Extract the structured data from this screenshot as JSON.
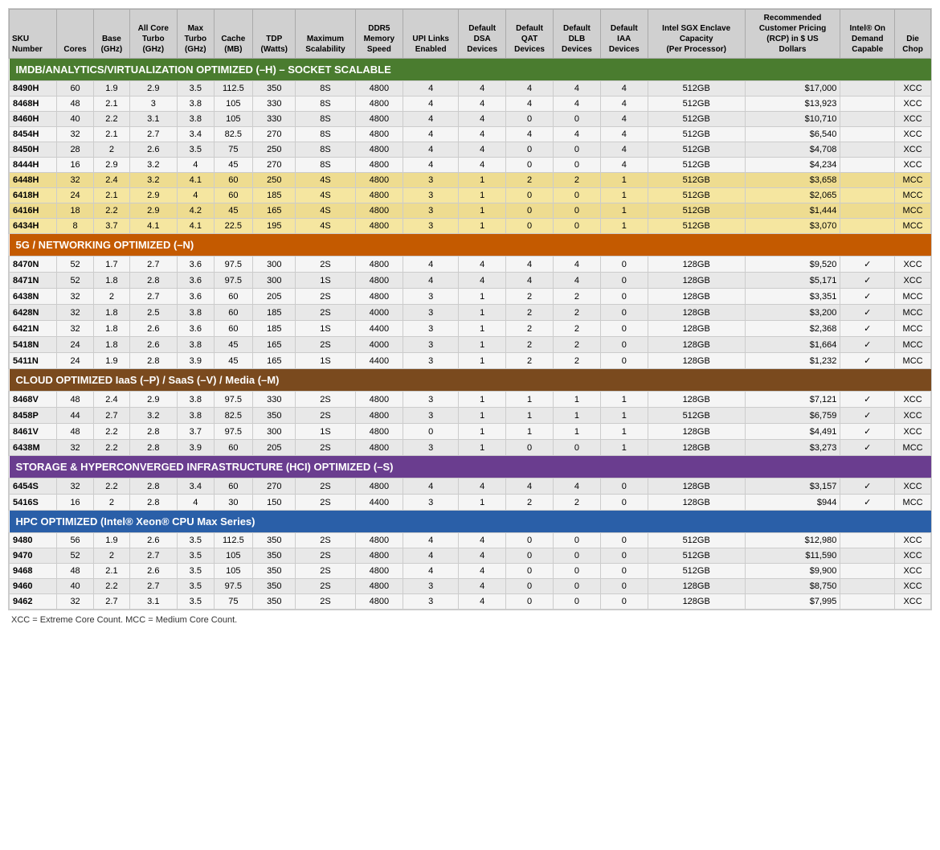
{
  "sections": [
    {
      "id": "imdb",
      "header": "IMDB/ANALYTICS/VIRTUALIZATION OPTIMIZED (–H) – SOCKET SCALABLE",
      "headerClass": "green-header",
      "rows": [
        {
          "sku": "8490H",
          "cores": "60",
          "base": "1.9",
          "allCore": "2.9",
          "maxTurbo": "3.5",
          "cache": "112.5",
          "tdp": "350",
          "maxScal": "8S",
          "ddr5": "4800",
          "upi": "4",
          "dsa": "4",
          "qat": "4",
          "dlb": "4",
          "iaa": "4",
          "sgx": "512GB",
          "price": "$17,000",
          "onDemand": "",
          "chop": "XCC",
          "yellow": false
        },
        {
          "sku": "8468H",
          "cores": "48",
          "base": "2.1",
          "allCore": "3",
          "maxTurbo": "3.8",
          "cache": "105",
          "tdp": "330",
          "maxScal": "8S",
          "ddr5": "4800",
          "upi": "4",
          "dsa": "4",
          "qat": "4",
          "dlb": "4",
          "iaa": "4",
          "sgx": "512GB",
          "price": "$13,923",
          "onDemand": "",
          "chop": "XCC",
          "yellow": false
        },
        {
          "sku": "8460H",
          "cores": "40",
          "base": "2.2",
          "allCore": "3.1",
          "maxTurbo": "3.8",
          "cache": "105",
          "tdp": "330",
          "maxScal": "8S",
          "ddr5": "4800",
          "upi": "4",
          "dsa": "4",
          "qat": "0",
          "dlb": "0",
          "iaa": "4",
          "sgx": "512GB",
          "price": "$10,710",
          "onDemand": "",
          "chop": "XCC",
          "yellow": false
        },
        {
          "sku": "8454H",
          "cores": "32",
          "base": "2.1",
          "allCore": "2.7",
          "maxTurbo": "3.4",
          "cache": "82.5",
          "tdp": "270",
          "maxScal": "8S",
          "ddr5": "4800",
          "upi": "4",
          "dsa": "4",
          "qat": "4",
          "dlb": "4",
          "iaa": "4",
          "sgx": "512GB",
          "price": "$6,540",
          "onDemand": "",
          "chop": "XCC",
          "yellow": false
        },
        {
          "sku": "8450H",
          "cores": "28",
          "base": "2",
          "allCore": "2.6",
          "maxTurbo": "3.5",
          "cache": "75",
          "tdp": "250",
          "maxScal": "8S",
          "ddr5": "4800",
          "upi": "4",
          "dsa": "4",
          "qat": "0",
          "dlb": "0",
          "iaa": "4",
          "sgx": "512GB",
          "price": "$4,708",
          "onDemand": "",
          "chop": "XCC",
          "yellow": false
        },
        {
          "sku": "8444H",
          "cores": "16",
          "base": "2.9",
          "allCore": "3.2",
          "maxTurbo": "4",
          "cache": "45",
          "tdp": "270",
          "maxScal": "8S",
          "ddr5": "4800",
          "upi": "4",
          "dsa": "4",
          "qat": "0",
          "dlb": "0",
          "iaa": "4",
          "sgx": "512GB",
          "price": "$4,234",
          "onDemand": "",
          "chop": "XCC",
          "yellow": false
        },
        {
          "sku": "6448H",
          "cores": "32",
          "base": "2.4",
          "allCore": "3.2",
          "maxTurbo": "4.1",
          "cache": "60",
          "tdp": "250",
          "maxScal": "4S",
          "ddr5": "4800",
          "upi": "3",
          "dsa": "1",
          "qat": "2",
          "dlb": "2",
          "iaa": "1",
          "sgx": "512GB",
          "price": "$3,658",
          "onDemand": "",
          "chop": "MCC",
          "yellow": true
        },
        {
          "sku": "6418H",
          "cores": "24",
          "base": "2.1",
          "allCore": "2.9",
          "maxTurbo": "4",
          "cache": "60",
          "tdp": "185",
          "maxScal": "4S",
          "ddr5": "4800",
          "upi": "3",
          "dsa": "1",
          "qat": "0",
          "dlb": "0",
          "iaa": "1",
          "sgx": "512GB",
          "price": "$2,065",
          "onDemand": "",
          "chop": "MCC",
          "yellow": true
        },
        {
          "sku": "6416H",
          "cores": "18",
          "base": "2.2",
          "allCore": "2.9",
          "maxTurbo": "4.2",
          "cache": "45",
          "tdp": "165",
          "maxScal": "4S",
          "ddr5": "4800",
          "upi": "3",
          "dsa": "1",
          "qat": "0",
          "dlb": "0",
          "iaa": "1",
          "sgx": "512GB",
          "price": "$1,444",
          "onDemand": "",
          "chop": "MCC",
          "yellow": true
        },
        {
          "sku": "6434H",
          "cores": "8",
          "base": "3.7",
          "allCore": "4.1",
          "maxTurbo": "4.1",
          "cache": "22.5",
          "tdp": "195",
          "maxScal": "4S",
          "ddr5": "4800",
          "upi": "3",
          "dsa": "1",
          "qat": "0",
          "dlb": "0",
          "iaa": "1",
          "sgx": "512GB",
          "price": "$3,070",
          "onDemand": "",
          "chop": "MCC",
          "yellow": true
        }
      ]
    },
    {
      "id": "5g",
      "header": "5G / NETWORKING OPTIMIZED (–N)",
      "headerClass": "orange-header",
      "rows": [
        {
          "sku": "8470N",
          "cores": "52",
          "base": "1.7",
          "allCore": "2.7",
          "maxTurbo": "3.6",
          "cache": "97.5",
          "tdp": "300",
          "maxScal": "2S",
          "ddr5": "4800",
          "upi": "4",
          "dsa": "4",
          "qat": "4",
          "dlb": "4",
          "iaa": "0",
          "sgx": "128GB",
          "price": "$9,520",
          "onDemand": "✓",
          "chop": "XCC",
          "yellow": false
        },
        {
          "sku": "8471N",
          "cores": "52",
          "base": "1.8",
          "allCore": "2.8",
          "maxTurbo": "3.6",
          "cache": "97.5",
          "tdp": "300",
          "maxScal": "1S",
          "ddr5": "4800",
          "upi": "4",
          "dsa": "4",
          "qat": "4",
          "dlb": "4",
          "iaa": "0",
          "sgx": "128GB",
          "price": "$5,171",
          "onDemand": "✓",
          "chop": "XCC",
          "yellow": false
        },
        {
          "sku": "6438N",
          "cores": "32",
          "base": "2",
          "allCore": "2.7",
          "maxTurbo": "3.6",
          "cache": "60",
          "tdp": "205",
          "maxScal": "2S",
          "ddr5": "4800",
          "upi": "3",
          "dsa": "1",
          "qat": "2",
          "dlb": "2",
          "iaa": "0",
          "sgx": "128GB",
          "price": "$3,351",
          "onDemand": "✓",
          "chop": "MCC",
          "yellow": false
        },
        {
          "sku": "6428N",
          "cores": "32",
          "base": "1.8",
          "allCore": "2.5",
          "maxTurbo": "3.8",
          "cache": "60",
          "tdp": "185",
          "maxScal": "2S",
          "ddr5": "4000",
          "upi": "3",
          "dsa": "1",
          "qat": "2",
          "dlb": "2",
          "iaa": "0",
          "sgx": "128GB",
          "price": "$3,200",
          "onDemand": "✓",
          "chop": "MCC",
          "yellow": false
        },
        {
          "sku": "6421N",
          "cores": "32",
          "base": "1.8",
          "allCore": "2.6",
          "maxTurbo": "3.6",
          "cache": "60",
          "tdp": "185",
          "maxScal": "1S",
          "ddr5": "4400",
          "upi": "3",
          "dsa": "1",
          "qat": "2",
          "dlb": "2",
          "iaa": "0",
          "sgx": "128GB",
          "price": "$2,368",
          "onDemand": "✓",
          "chop": "MCC",
          "yellow": false
        },
        {
          "sku": "5418N",
          "cores": "24",
          "base": "1.8",
          "allCore": "2.6",
          "maxTurbo": "3.8",
          "cache": "45",
          "tdp": "165",
          "maxScal": "2S",
          "ddr5": "4000",
          "upi": "3",
          "dsa": "1",
          "qat": "2",
          "dlb": "2",
          "iaa": "0",
          "sgx": "128GB",
          "price": "$1,664",
          "onDemand": "✓",
          "chop": "MCC",
          "yellow": false
        },
        {
          "sku": "5411N",
          "cores": "24",
          "base": "1.9",
          "allCore": "2.8",
          "maxTurbo": "3.9",
          "cache": "45",
          "tdp": "165",
          "maxScal": "1S",
          "ddr5": "4400",
          "upi": "3",
          "dsa": "1",
          "qat": "2",
          "dlb": "2",
          "iaa": "0",
          "sgx": "128GB",
          "price": "$1,232",
          "onDemand": "✓",
          "chop": "MCC",
          "yellow": false
        }
      ]
    },
    {
      "id": "cloud",
      "header": "CLOUD OPTIMIZED IaaS (–P) / SaaS (–V) / Media (–M)",
      "headerClass": "brown-header",
      "rows": [
        {
          "sku": "8468V",
          "cores": "48",
          "base": "2.4",
          "allCore": "2.9",
          "maxTurbo": "3.8",
          "cache": "97.5",
          "tdp": "330",
          "maxScal": "2S",
          "ddr5": "4800",
          "upi": "3",
          "dsa": "1",
          "qat": "1",
          "dlb": "1",
          "iaa": "1",
          "sgx": "128GB",
          "price": "$7,121",
          "onDemand": "✓",
          "chop": "XCC",
          "yellow": false
        },
        {
          "sku": "8458P",
          "cores": "44",
          "base": "2.7",
          "allCore": "3.2",
          "maxTurbo": "3.8",
          "cache": "82.5",
          "tdp": "350",
          "maxScal": "2S",
          "ddr5": "4800",
          "upi": "3",
          "dsa": "1",
          "qat": "1",
          "dlb": "1",
          "iaa": "1",
          "sgx": "512GB",
          "price": "$6,759",
          "onDemand": "✓",
          "chop": "XCC",
          "yellow": false
        },
        {
          "sku": "8461V",
          "cores": "48",
          "base": "2.2",
          "allCore": "2.8",
          "maxTurbo": "3.7",
          "cache": "97.5",
          "tdp": "300",
          "maxScal": "1S",
          "ddr5": "4800",
          "upi": "0",
          "dsa": "1",
          "qat": "1",
          "dlb": "1",
          "iaa": "1",
          "sgx": "128GB",
          "price": "$4,491",
          "onDemand": "✓",
          "chop": "XCC",
          "yellow": false
        },
        {
          "sku": "6438M",
          "cores": "32",
          "base": "2.2",
          "allCore": "2.8",
          "maxTurbo": "3.9",
          "cache": "60",
          "tdp": "205",
          "maxScal": "2S",
          "ddr5": "4800",
          "upi": "3",
          "dsa": "1",
          "qat": "0",
          "dlb": "0",
          "iaa": "1",
          "sgx": "128GB",
          "price": "$3,273",
          "onDemand": "✓",
          "chop": "MCC",
          "yellow": false
        }
      ]
    },
    {
      "id": "storage",
      "header": "STORAGE & HYPERCONVERGED INFRASTRUCTURE (HCI) OPTIMIZED (–S)",
      "headerClass": "purple-header",
      "rows": [
        {
          "sku": "6454S",
          "cores": "32",
          "base": "2.2",
          "allCore": "2.8",
          "maxTurbo": "3.4",
          "cache": "60",
          "tdp": "270",
          "maxScal": "2S",
          "ddr5": "4800",
          "upi": "4",
          "dsa": "4",
          "qat": "4",
          "dlb": "4",
          "iaa": "0",
          "sgx": "128GB",
          "price": "$3,157",
          "onDemand": "✓",
          "chop": "XCC",
          "yellow": false
        },
        {
          "sku": "5416S",
          "cores": "16",
          "base": "2",
          "allCore": "2.8",
          "maxTurbo": "4",
          "cache": "30",
          "tdp": "150",
          "maxScal": "2S",
          "ddr5": "4400",
          "upi": "3",
          "dsa": "1",
          "qat": "2",
          "dlb": "2",
          "iaa": "0",
          "sgx": "128GB",
          "price": "$944",
          "onDemand": "✓",
          "chop": "MCC",
          "yellow": false
        }
      ]
    },
    {
      "id": "hpc",
      "header": "HPC OPTIMIZED (Intel® Xeon® CPU Max Series)",
      "headerClass": "blue-header",
      "rows": [
        {
          "sku": "9480",
          "cores": "56",
          "base": "1.9",
          "allCore": "2.6",
          "maxTurbo": "3.5",
          "cache": "112.5",
          "tdp": "350",
          "maxScal": "2S",
          "ddr5": "4800",
          "upi": "4",
          "dsa": "4",
          "qat": "0",
          "dlb": "0",
          "iaa": "0",
          "sgx": "512GB",
          "price": "$12,980",
          "onDemand": "",
          "chop": "XCC",
          "yellow": false
        },
        {
          "sku": "9470",
          "cores": "52",
          "base": "2",
          "allCore": "2.7",
          "maxTurbo": "3.5",
          "cache": "105",
          "tdp": "350",
          "maxScal": "2S",
          "ddr5": "4800",
          "upi": "4",
          "dsa": "4",
          "qat": "0",
          "dlb": "0",
          "iaa": "0",
          "sgx": "512GB",
          "price": "$11,590",
          "onDemand": "",
          "chop": "XCC",
          "yellow": false
        },
        {
          "sku": "9468",
          "cores": "48",
          "base": "2.1",
          "allCore": "2.6",
          "maxTurbo": "3.5",
          "cache": "105",
          "tdp": "350",
          "maxScal": "2S",
          "ddr5": "4800",
          "upi": "4",
          "dsa": "4",
          "qat": "0",
          "dlb": "0",
          "iaa": "0",
          "sgx": "512GB",
          "price": "$9,900",
          "onDemand": "",
          "chop": "XCC",
          "yellow": false
        },
        {
          "sku": "9460",
          "cores": "40",
          "base": "2.2",
          "allCore": "2.7",
          "maxTurbo": "3.5",
          "cache": "97.5",
          "tdp": "350",
          "maxScal": "2S",
          "ddr5": "4800",
          "upi": "3",
          "dsa": "4",
          "qat": "0",
          "dlb": "0",
          "iaa": "0",
          "sgx": "128GB",
          "price": "$8,750",
          "onDemand": "",
          "chop": "XCC",
          "yellow": false
        },
        {
          "sku": "9462",
          "cores": "32",
          "base": "2.7",
          "allCore": "3.1",
          "maxTurbo": "3.5",
          "cache": "75",
          "tdp": "350",
          "maxScal": "2S",
          "ddr5": "4800",
          "upi": "3",
          "dsa": "4",
          "qat": "0",
          "dlb": "0",
          "iaa": "0",
          "sgx": "128GB",
          "price": "$7,995",
          "onDemand": "",
          "chop": "XCC",
          "yellow": false
        }
      ]
    }
  ],
  "columnHeaders": [
    {
      "label": "SKU\nNumber",
      "key": "sku"
    },
    {
      "label": "Cores",
      "key": "cores"
    },
    {
      "label": "Base\n(GHz)",
      "key": "base"
    },
    {
      "label": "All Core\nTurbo\n(GHz)",
      "key": "allCore"
    },
    {
      "label": "Max\nTurbo\n(GHz)",
      "key": "maxTurbo"
    },
    {
      "label": "Cache\n(MB)",
      "key": "cache"
    },
    {
      "label": "TDP\n(Watts)",
      "key": "tdp"
    },
    {
      "label": "Maximum\nScalability",
      "key": "maxScal"
    },
    {
      "label": "DDR5\nMemory\nSpeed",
      "key": "ddr5"
    },
    {
      "label": "UPI Links\nEnabled",
      "key": "upi"
    },
    {
      "label": "Default\nDSA\nDevices",
      "key": "dsa"
    },
    {
      "label": "Default\nQAT\nDevices",
      "key": "qat"
    },
    {
      "label": "Default\nDLB\nDevices",
      "key": "dlb"
    },
    {
      "label": "Default\nIAA\nDevices",
      "key": "iaa"
    },
    {
      "label": "Intel SGX Enclave\nCapacity\n(Per Processor)",
      "key": "sgx"
    },
    {
      "label": "Recommended\nCustomer Pricing\n(RCP) in $ US\nDollars",
      "key": "price"
    },
    {
      "label": "Intel® On\nDemand\nCapable",
      "key": "onDemand"
    },
    {
      "label": "Die\nChop",
      "key": "chop"
    }
  ],
  "footnote": "XCC = Extreme Core Count.   MCC = Medium Core Count."
}
